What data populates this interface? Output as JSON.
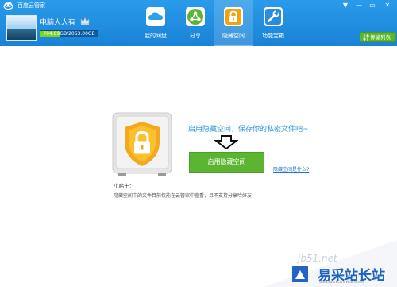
{
  "window": {
    "title": "百度云管家",
    "controls": {
      "menu": "▼",
      "minimize": "—",
      "maximize": "▭",
      "close": "✕"
    }
  },
  "user": {
    "name": "电脑人人有",
    "quota_text": "704.89GB/2063.00GB",
    "quota_fraction": 0.342
  },
  "nav": {
    "tabs": [
      {
        "label": "我的网盘",
        "icon": "cloud-icon",
        "color": "#2aa1e8",
        "active": false
      },
      {
        "label": "分享",
        "icon": "share-icon",
        "color": "#5cb531",
        "active": false
      },
      {
        "label": "隐藏空间",
        "icon": "lock-icon",
        "color": "#f0a30c",
        "active": true
      },
      {
        "label": "功能宝箱",
        "icon": "toolbox-icon",
        "color": "#2a8be0",
        "active": false
      }
    ]
  },
  "transfer_list": {
    "label": "传输列表"
  },
  "hidden_space": {
    "promo": "启用隐藏空间，保存你的私密文件吧~",
    "enable_button": "启用隐藏空间",
    "help_link": "隐藏空间是什么?",
    "tip_title": "小贴士：",
    "tip_text": "隐藏空间中的文件目前仅能在云管家中查看，且不支持分享哈好友"
  },
  "watermark": {
    "domain": "jb51.net",
    "brand": "易采站长站",
    "tagline": "Www.EasckCom Webmaster"
  },
  "colors": {
    "header": "#1a8ee0",
    "accent_green": "#5cb531",
    "link_blue": "#1d6fd1",
    "promo_blue": "#2d97db"
  }
}
